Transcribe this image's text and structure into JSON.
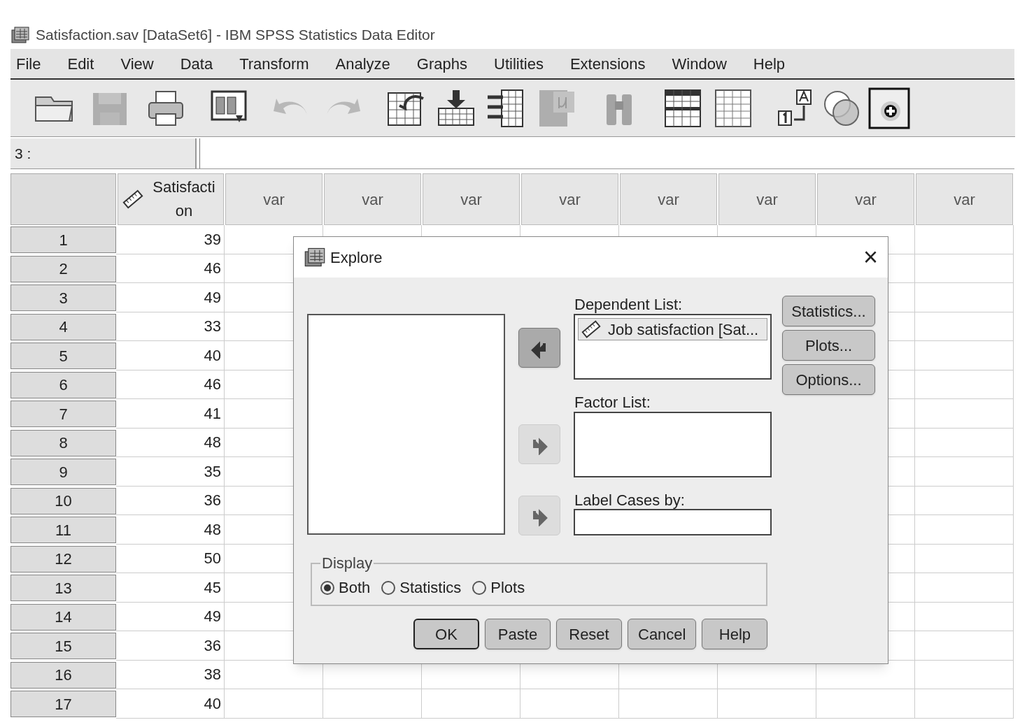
{
  "window": {
    "title": "Satisfaction.sav [DataSet6] - IBM SPSS Statistics Data Editor"
  },
  "menu": [
    "File",
    "Edit",
    "View",
    "Data",
    "Transform",
    "Analyze",
    "Graphs",
    "Utilities",
    "Extensions",
    "Window",
    "Help"
  ],
  "toolbar": [
    {
      "kind": "open",
      "disabled": false
    },
    {
      "kind": "save",
      "disabled": true
    },
    {
      "kind": "print",
      "disabled": false
    },
    {
      "kind": "dialog",
      "disabled": false
    },
    {
      "kind": "undo",
      "disabled": true
    },
    {
      "kind": "redo",
      "disabled": true
    },
    {
      "kind": "goto",
      "disabled": false
    },
    {
      "kind": "insert",
      "disabled": false
    },
    {
      "kind": "table",
      "disabled": false
    },
    {
      "kind": "variables",
      "disabled": true
    },
    {
      "kind": "find",
      "disabled": true
    },
    {
      "kind": "split",
      "disabled": false
    },
    {
      "kind": "grid",
      "disabled": false
    },
    {
      "kind": "labels",
      "disabled": false
    },
    {
      "kind": "circles",
      "disabled": false
    },
    {
      "kind": "add",
      "disabled": false
    }
  ],
  "cell_reference": "3 :",
  "table": {
    "columns": [
      {
        "name": "Satisfaction",
        "kind": "variable"
      },
      {
        "name": "var",
        "kind": "empty"
      },
      {
        "name": "var",
        "kind": "empty"
      },
      {
        "name": "var",
        "kind": "empty"
      },
      {
        "name": "var",
        "kind": "empty"
      },
      {
        "name": "var",
        "kind": "empty"
      },
      {
        "name": "var",
        "kind": "empty"
      },
      {
        "name": "var",
        "kind": "empty"
      },
      {
        "name": "var",
        "kind": "empty"
      }
    ],
    "rows": [
      {
        "row": "1",
        "value": "39"
      },
      {
        "row": "2",
        "value": "46"
      },
      {
        "row": "3",
        "value": "49"
      },
      {
        "row": "4",
        "value": "33"
      },
      {
        "row": "5",
        "value": "40"
      },
      {
        "row": "6",
        "value": "46"
      },
      {
        "row": "7",
        "value": "41"
      },
      {
        "row": "8",
        "value": "48"
      },
      {
        "row": "9",
        "value": "35"
      },
      {
        "row": "10",
        "value": "36"
      },
      {
        "row": "11",
        "value": "48"
      },
      {
        "row": "12",
        "value": "50"
      },
      {
        "row": "13",
        "value": "45"
      },
      {
        "row": "14",
        "value": "49"
      },
      {
        "row": "15",
        "value": "36"
      },
      {
        "row": "16",
        "value": "38"
      },
      {
        "row": "17",
        "value": "40"
      }
    ]
  },
  "dialog": {
    "title": "Explore",
    "close": "×",
    "move_buttons": [
      {
        "kind": "left",
        "disabled": false
      },
      {
        "kind": "right",
        "disabled": true
      },
      {
        "kind": "right",
        "disabled": true
      }
    ],
    "dependent_list": {
      "label": "Dependent List:",
      "items": [
        "Job satisfaction [Sat..."
      ]
    },
    "factor_list": {
      "label": "Factor List:"
    },
    "label_cases": {
      "label": "Label Cases by:"
    },
    "side_buttons": [
      "Statistics...",
      "Plots...",
      "Options..."
    ],
    "display": {
      "label": "Display",
      "options": [
        {
          "label": "Both",
          "selected": true
        },
        {
          "label": "Statistics",
          "selected": false
        },
        {
          "label": "Plots",
          "selected": false
        }
      ]
    },
    "buttons": [
      {
        "label": "OK",
        "default": true
      },
      {
        "label": "Paste",
        "default": false
      },
      {
        "label": "Reset",
        "default": false
      },
      {
        "label": "Cancel",
        "default": false
      },
      {
        "label": "Help",
        "default": false
      }
    ]
  }
}
